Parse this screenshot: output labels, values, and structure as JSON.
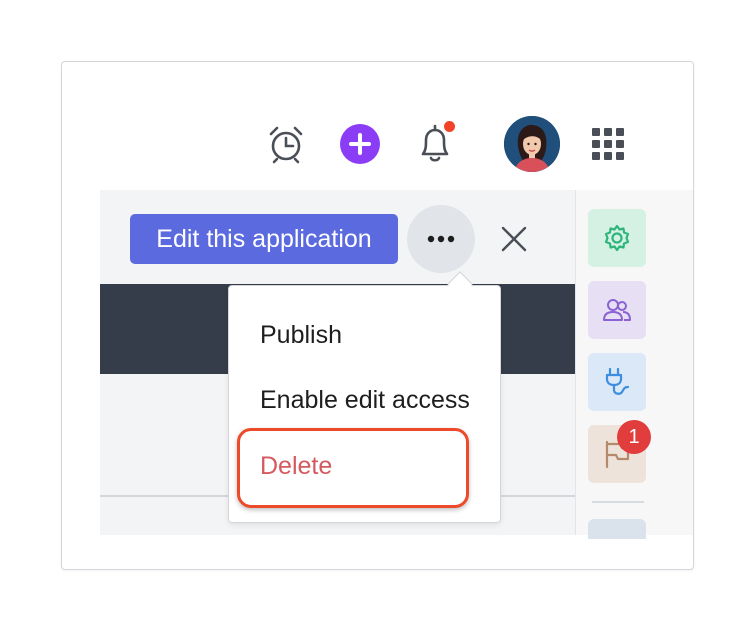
{
  "header": {
    "icons": [
      "alarm-clock-icon",
      "plus-icon",
      "bell-icon",
      "avatar",
      "apps-grid-icon"
    ],
    "plus_color": "#8b3df5",
    "notification_dot_color": "#f0432a"
  },
  "toolbar": {
    "edit_label": "Edit this application",
    "edit_color": "#5c6ae0"
  },
  "menu": {
    "items": [
      {
        "label": "Publish"
      },
      {
        "label": "Enable edit access"
      },
      {
        "label": "Delete",
        "color": "#d45a60",
        "highlighted": true
      }
    ],
    "highlight_color": "#ec4a2a"
  },
  "rail": {
    "buttons": [
      "settings-gear-icon",
      "people-icon",
      "plug-icon",
      "flag-icon"
    ],
    "flag_badge": "1"
  }
}
